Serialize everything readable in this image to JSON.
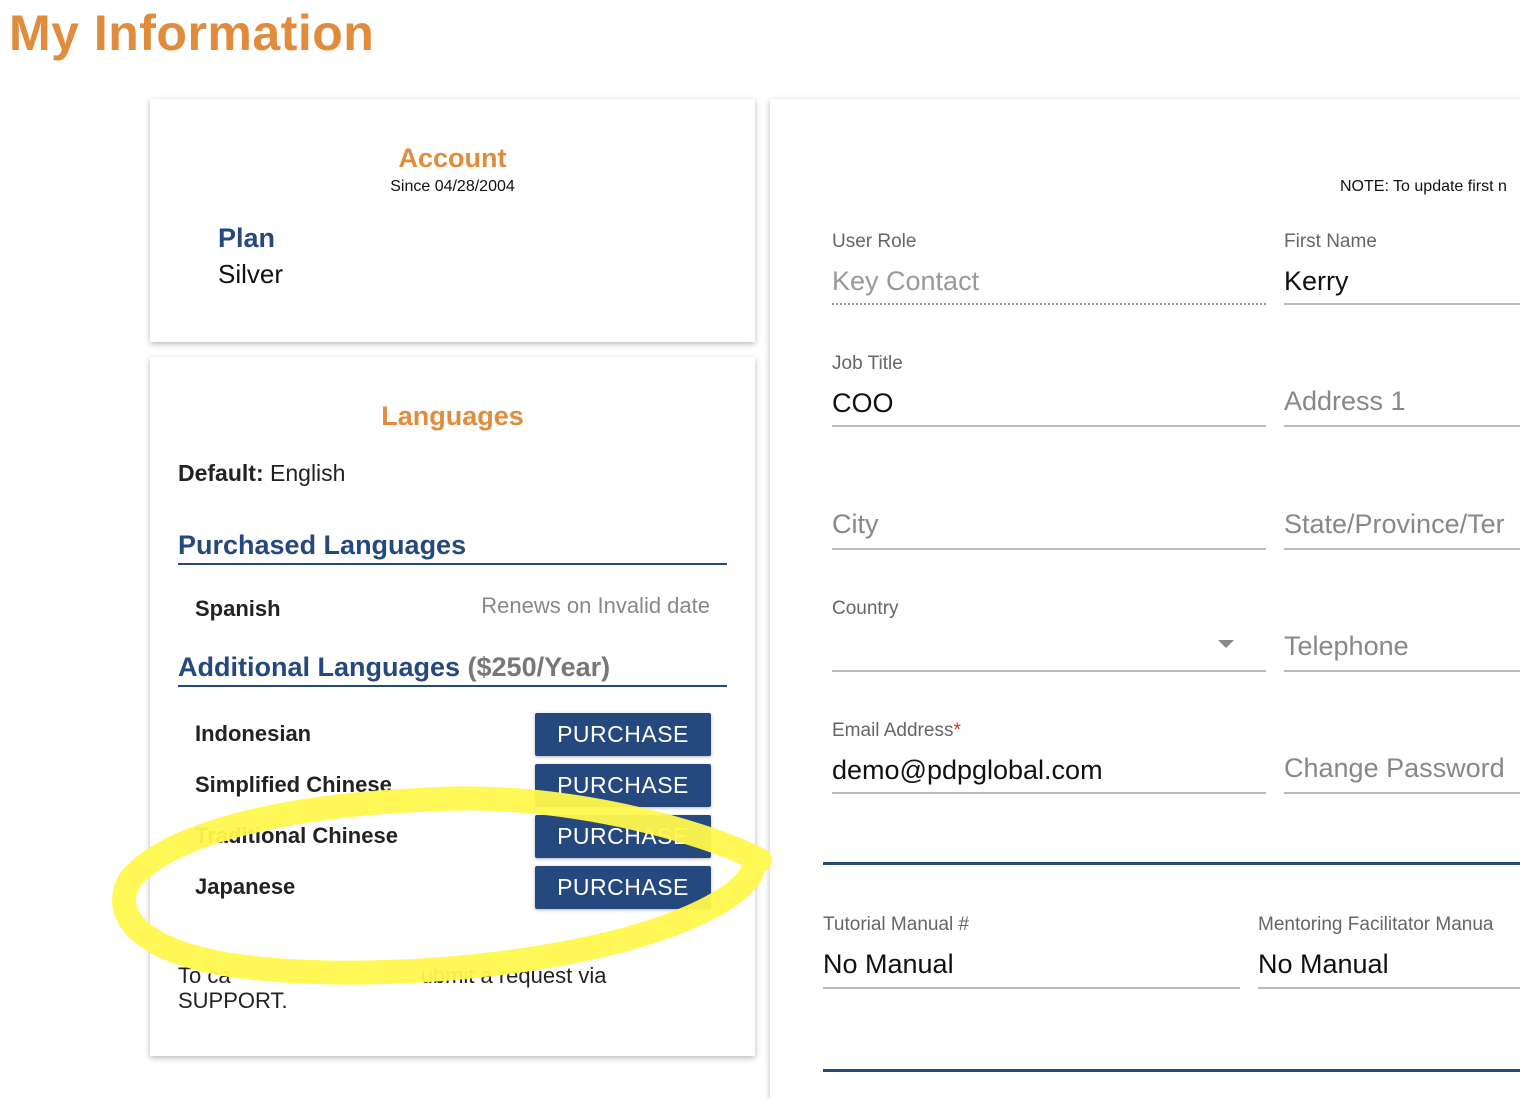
{
  "page": {
    "title": "My Information"
  },
  "account": {
    "heading": "Account",
    "since": "Since 04/28/2004",
    "plan_label": "Plan",
    "plan_value": "Silver"
  },
  "languages": {
    "heading": "Languages",
    "default_label": "Default:",
    "default_value": "English",
    "purchased_title": "Purchased Languages",
    "purchased": [
      {
        "name": "Spanish",
        "status": "Renews on Invalid date"
      }
    ],
    "additional_title": "Additional Languages",
    "additional_price": "($250/Year)",
    "additional": [
      {
        "name": "Indonesian",
        "button": "PURCHASE"
      },
      {
        "name": "Simplified Chinese",
        "button": "PURCHASE"
      },
      {
        "name": "Traditional Chinese",
        "button": "PURCHASE"
      },
      {
        "name": "Japanese",
        "button": "PURCHASE"
      }
    ],
    "cancel_note_start": "To ca",
    "cancel_note_end": "ubmit a request via",
    "cancel_note_line2": "SUPPORT."
  },
  "profile": {
    "note": "NOTE: To update first n",
    "user_role": {
      "label": "User Role",
      "value": "Key Contact"
    },
    "first_name": {
      "label": "First Name",
      "value": "Kerry"
    },
    "job_title": {
      "label": "Job Title",
      "value": "COO"
    },
    "address1": {
      "placeholder": "Address 1"
    },
    "city": {
      "placeholder": "City"
    },
    "state": {
      "placeholder": "State/Province/Ter"
    },
    "country": {
      "label": "Country",
      "value": ""
    },
    "telephone": {
      "placeholder": "Telephone"
    },
    "email": {
      "label": "Email Address",
      "required_mark": "*",
      "value": "demo@pdpglobal.com"
    },
    "change_password": {
      "placeholder": "Change Password"
    },
    "tutorial_manual": {
      "label": "Tutorial Manual #",
      "value": "No Manual"
    },
    "mentoring_manual": {
      "label": "Mentoring Facilitator Manua",
      "value": "No Manual"
    }
  },
  "colors": {
    "accent_orange": "#e08c3c",
    "primary_blue": "#25487e",
    "highlight_yellow": "#fff84d"
  }
}
